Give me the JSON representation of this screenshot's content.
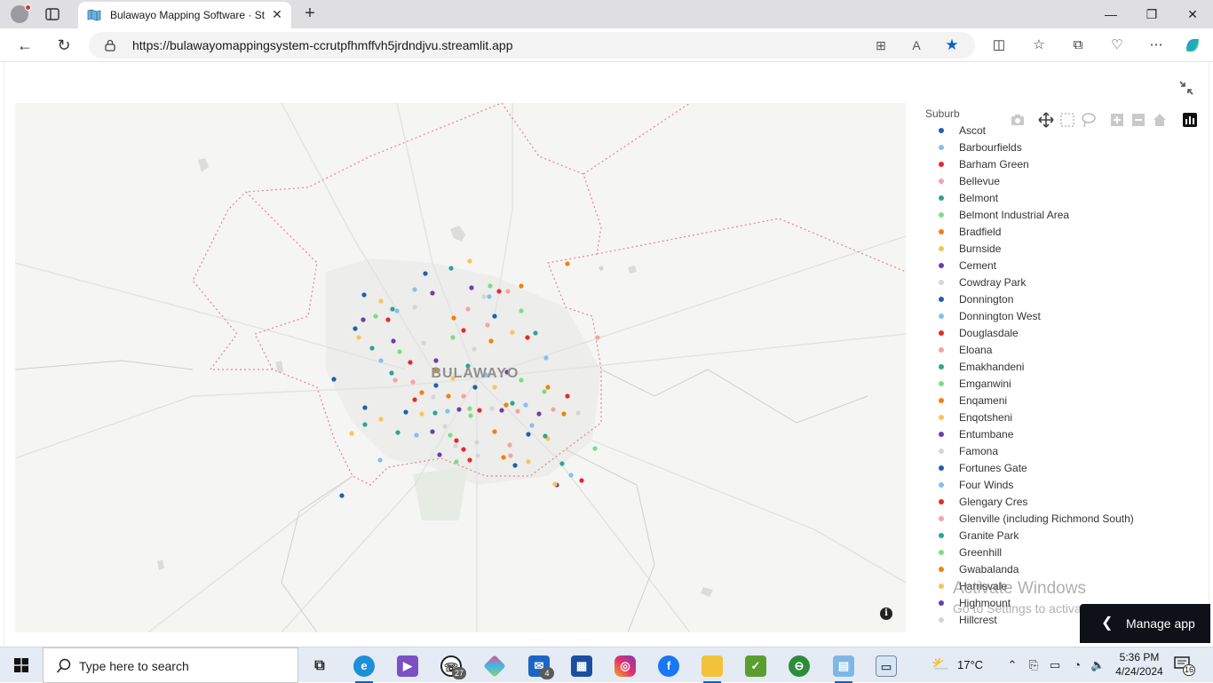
{
  "browser": {
    "tab_title": "Bulawayo Mapping Software · St",
    "url": "https://bulawayomappingsystem-ccrutpfhmffvh5jrdndjvu.streamlit.app"
  },
  "map": {
    "city_label": "BULAWAYO",
    "info_symbol": "i"
  },
  "legend": {
    "title": "Suburb",
    "items": [
      {
        "label": "Ascot",
        "color": "#1f5fae"
      },
      {
        "label": "Barbourfields",
        "color": "#86c0ea"
      },
      {
        "label": "Barham Green",
        "color": "#e8292a"
      },
      {
        "label": "Bellevue",
        "color": "#f2a3a5"
      },
      {
        "label": "Belmont",
        "color": "#2ca58d"
      },
      {
        "label": "Belmont Industrial Area",
        "color": "#7ddc87"
      },
      {
        "label": "Bradfield",
        "color": "#f0820f"
      },
      {
        "label": "Burnside",
        "color": "#f8c45c"
      },
      {
        "label": "Cement",
        "color": "#6a3fa8"
      },
      {
        "label": "Cowdray Park",
        "color": "#d4d4dc"
      },
      {
        "label": "Donnington",
        "color": "#1f5fae"
      },
      {
        "label": "Donnington West",
        "color": "#86c0ea"
      },
      {
        "label": "Douglasdale",
        "color": "#e8292a"
      },
      {
        "label": "Eloana",
        "color": "#f2a3a5"
      },
      {
        "label": "Emakhandeni",
        "color": "#2ca58d"
      },
      {
        "label": "Emganwini",
        "color": "#7ddc87"
      },
      {
        "label": "Enqameni",
        "color": "#f0820f"
      },
      {
        "label": "Enqotsheni",
        "color": "#f8c45c"
      },
      {
        "label": "Entumbane",
        "color": "#6a3fa8"
      },
      {
        "label": "Famona",
        "color": "#d4d4dc"
      },
      {
        "label": "Fortunes Gate",
        "color": "#1f5fae"
      },
      {
        "label": "Four Winds",
        "color": "#86c0ea"
      },
      {
        "label": "Glengary Cres",
        "color": "#e8292a"
      },
      {
        "label": "Glenville (including Richmond South)",
        "color": "#f2a3a5"
      },
      {
        "label": "Granite Park",
        "color": "#2ca58d"
      },
      {
        "label": "Greenhill",
        "color": "#7ddc87"
      },
      {
        "label": "Gwabalanda",
        "color": "#f0820f"
      },
      {
        "label": "Harrisvale",
        "color": "#f8c45c"
      },
      {
        "label": "Highmount",
        "color": "#6a3fa8"
      },
      {
        "label": "Hillcrest",
        "color": "#d4d4dc"
      }
    ]
  },
  "watermark": {
    "line1": "Activate Windows",
    "line2": "Go to Settings to activate Windows."
  },
  "manage_app": {
    "label": "Manage app"
  },
  "taskbar": {
    "search_placeholder": "Type here to search",
    "whatsapp_badge": "27",
    "mail_badge": "4",
    "temperature": "17°C",
    "time": "5:36 PM",
    "date": "4/24/2024",
    "notification_count": "16"
  }
}
